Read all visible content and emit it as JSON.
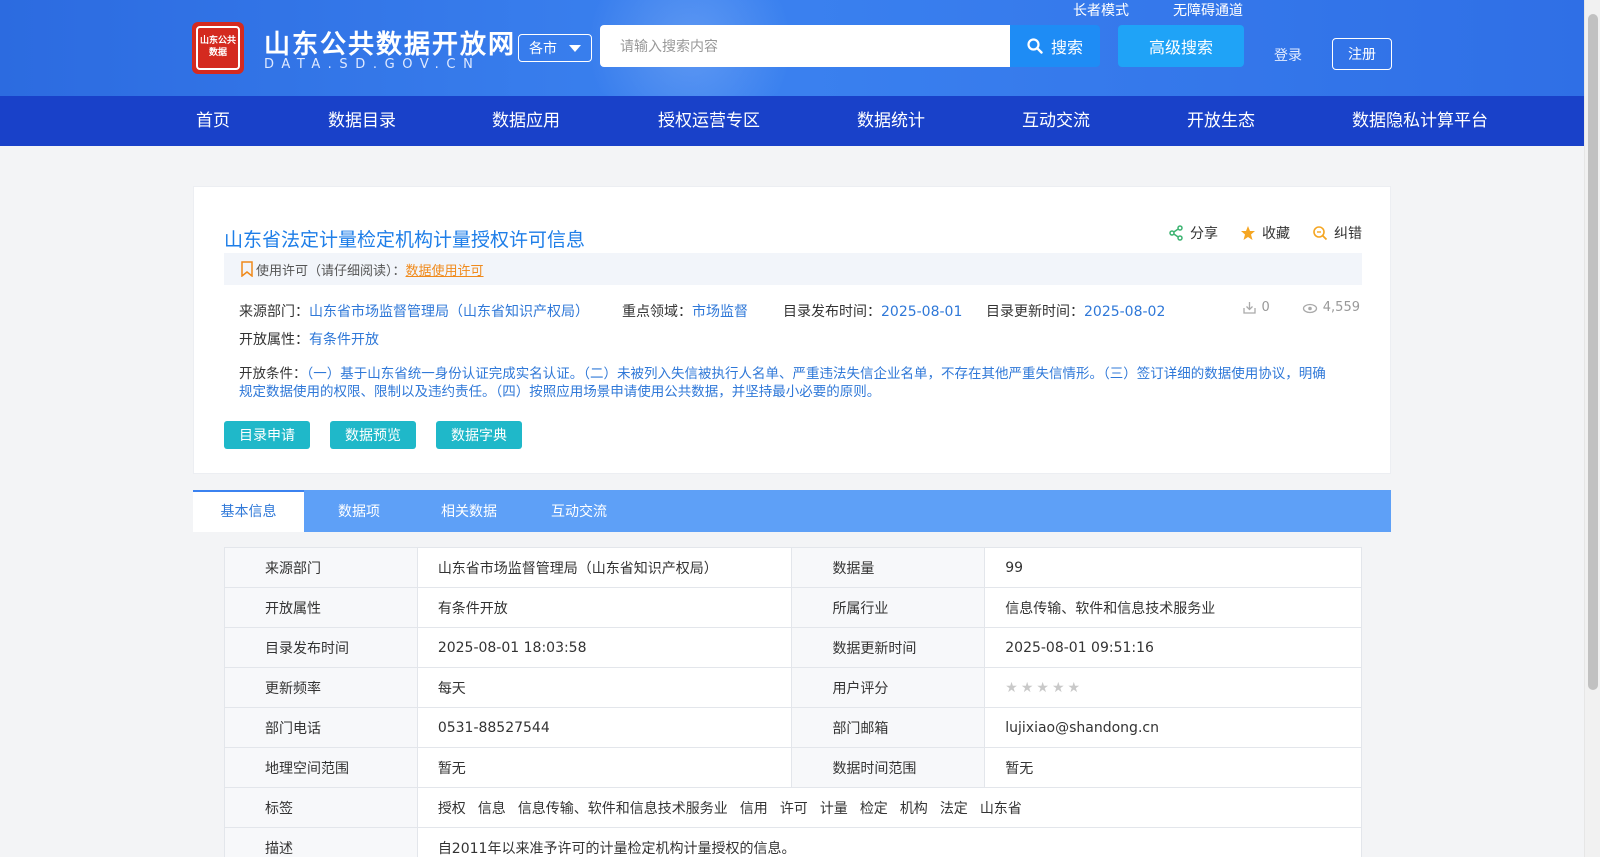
{
  "header": {
    "logo_mark": "山东公共数据",
    "site_title": "山东公共数据开放网",
    "site_subtitle": "DATA.SD.GOV.CN",
    "city_select": "各市",
    "search_placeholder": "请输入搜索内容",
    "search_button": "搜索",
    "advanced_search": "高级搜索",
    "elder_mode": "长者模式",
    "accessibility": "无障碍通道",
    "login": "登录",
    "register": "注册"
  },
  "nav": [
    "首页",
    "数据目录",
    "数据应用",
    "授权运营专区",
    "数据统计",
    "互动交流",
    "开放生态",
    "数据隐私计算平台"
  ],
  "dataset": {
    "title": "山东省法定计量检定机构计量授权许可信息",
    "actions": {
      "share": "分享",
      "favorite": "收藏",
      "report": "纠错"
    },
    "license_label": "使用许可（请仔细阅读）：",
    "license_link": "数据使用许可",
    "source_label": "来源部门：",
    "source_value": "山东省市场监督管理局（山东省知识产权局）",
    "domain_label": "重点领域：",
    "domain_value": "市场监督",
    "publish_label": "目录发布时间：",
    "publish_value": "2025-08-01",
    "update_label": "目录更新时间：",
    "update_value": "2025-08-02",
    "downloads": "0",
    "views": "4,559",
    "open_attr_label": "开放属性：",
    "open_attr_value": "有条件开放",
    "conditions_label": "开放条件：",
    "conditions_value": "（一）基于山东省统一身份认证完成实名认证。（二）未被列入失信被执行人名单、严重违法失信企业名单，不存在其他严重失信情形。（三）签订详细的数据使用协议，明确规定数据使用的权限、限制以及违约责任。（四）按照应用场景申请使用公共数据，并坚持最小必要的原则。",
    "buttons": {
      "apply": "目录申请",
      "preview": "数据预览",
      "dictionary": "数据字典"
    }
  },
  "tabs": [
    "基本信息",
    "数据项",
    "相关数据",
    "互动交流"
  ],
  "info": {
    "rows": [
      [
        {
          "label": "来源部门",
          "value": "山东省市场监督管理局（山东省知识产权局）"
        },
        {
          "label": "数据量",
          "value": "99"
        }
      ],
      [
        {
          "label": "开放属性",
          "value": "有条件开放"
        },
        {
          "label": "所属行业",
          "value": "信息传输、软件和信息技术服务业"
        }
      ],
      [
        {
          "label": "目录发布时间",
          "value": "2025-08-01 18:03:58"
        },
        {
          "label": "数据更新时间",
          "value": "2025-08-01 09:51:16"
        }
      ],
      [
        {
          "label": "更新频率",
          "value": "每天"
        },
        {
          "label": "用户评分",
          "value": ""
        }
      ],
      [
        {
          "label": "部门电话",
          "value": "0531-88527544"
        },
        {
          "label": "部门邮箱",
          "value": "lujixiao@shandong.cn"
        }
      ],
      [
        {
          "label": "地理空间范围",
          "value": "暂无"
        },
        {
          "label": "数据时间范围",
          "value": "暂无"
        }
      ]
    ],
    "user_rating_stars": 0,
    "tags_label": "标签",
    "tags": [
      "授权",
      "信息",
      "信息传输、软件和信息技术服务业",
      "信用",
      "许可",
      "计量",
      "检定",
      "机构",
      "法定",
      "山东省"
    ],
    "desc_label": "描述",
    "desc_value": "自2011年以来准予许可的计量检定机构计量授权的信息。"
  },
  "colors": {
    "nav_bg": "#1941c9",
    "header_bg": "#2f6fe6",
    "link": "#2f78d8",
    "teal_button": "#1fb8c9",
    "tab_bar": "#5ea0f7"
  }
}
